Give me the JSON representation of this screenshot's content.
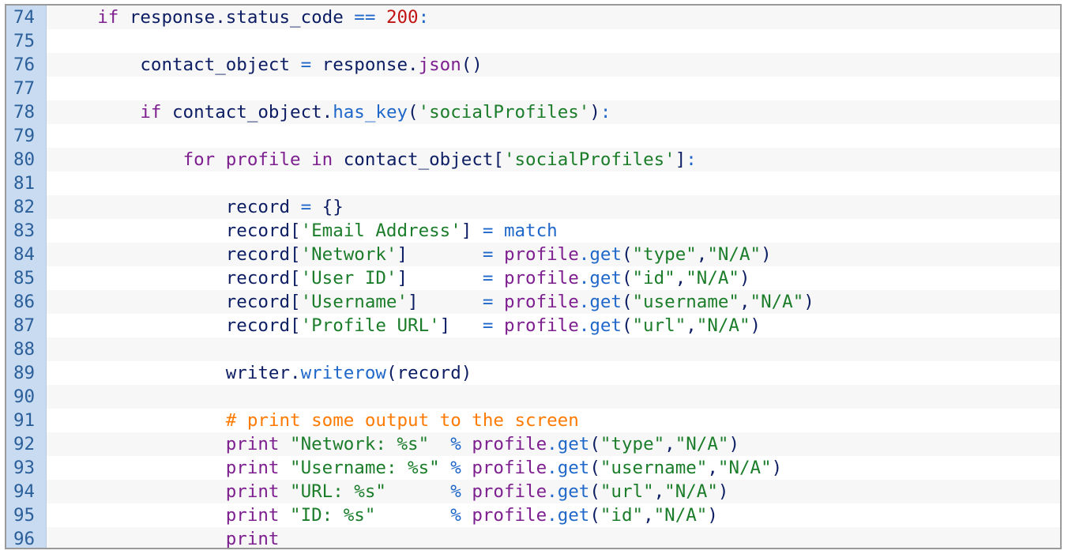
{
  "editor": {
    "lines": [
      {
        "number": "74",
        "tokens": [
          {
            "text": "    ",
            "type": "plain"
          },
          {
            "text": "if",
            "type": "kw"
          },
          {
            "text": " response.status_code ",
            "type": "name"
          },
          {
            "text": "==",
            "type": "op"
          },
          {
            "text": " ",
            "type": "plain"
          },
          {
            "text": "200",
            "type": "num"
          },
          {
            "text": ":",
            "type": "op"
          }
        ]
      },
      {
        "number": "75",
        "tokens": []
      },
      {
        "number": "76",
        "tokens": [
          {
            "text": "        contact_object ",
            "type": "name"
          },
          {
            "text": "=",
            "type": "op"
          },
          {
            "text": " response.",
            "type": "name"
          },
          {
            "text": "json",
            "type": "kw"
          },
          {
            "text": "()",
            "type": "plain"
          }
        ]
      },
      {
        "number": "77",
        "tokens": []
      },
      {
        "number": "78",
        "tokens": [
          {
            "text": "        ",
            "type": "plain"
          },
          {
            "text": "if",
            "type": "kw"
          },
          {
            "text": " contact_object.",
            "type": "name"
          },
          {
            "text": "has_key",
            "type": "fn"
          },
          {
            "text": "(",
            "type": "plain"
          },
          {
            "text": "'socialProfiles'",
            "type": "str"
          },
          {
            "text": ")",
            "type": "plain"
          },
          {
            "text": ":",
            "type": "op"
          }
        ]
      },
      {
        "number": "79",
        "tokens": []
      },
      {
        "number": "80",
        "tokens": [
          {
            "text": "            ",
            "type": "plain"
          },
          {
            "text": "for",
            "type": "kw"
          },
          {
            "text": " ",
            "type": "plain"
          },
          {
            "text": "profile",
            "type": "kw"
          },
          {
            "text": " ",
            "type": "plain"
          },
          {
            "text": "in",
            "type": "kw"
          },
          {
            "text": " contact_object[",
            "type": "name"
          },
          {
            "text": "'socialProfiles'",
            "type": "str"
          },
          {
            "text": "]",
            "type": "plain"
          },
          {
            "text": ":",
            "type": "op"
          }
        ]
      },
      {
        "number": "81",
        "tokens": []
      },
      {
        "number": "82",
        "tokens": [
          {
            "text": "                record ",
            "type": "name"
          },
          {
            "text": "=",
            "type": "op"
          },
          {
            "text": " {}",
            "type": "plain"
          }
        ]
      },
      {
        "number": "83",
        "tokens": [
          {
            "text": "                record[",
            "type": "name"
          },
          {
            "text": "'Email Address'",
            "type": "str"
          },
          {
            "text": "] ",
            "type": "plain"
          },
          {
            "text": "=",
            "type": "op"
          },
          {
            "text": " ",
            "type": "plain"
          },
          {
            "text": "match",
            "type": "fn"
          }
        ]
      },
      {
        "number": "84",
        "tokens": [
          {
            "text": "                record[",
            "type": "name"
          },
          {
            "text": "'Network'",
            "type": "str"
          },
          {
            "text": "]       ",
            "type": "plain"
          },
          {
            "text": "=",
            "type": "op"
          },
          {
            "text": " ",
            "type": "plain"
          },
          {
            "text": "profile",
            "type": "kw"
          },
          {
            "text": ".",
            "type": "op"
          },
          {
            "text": "get",
            "type": "fn"
          },
          {
            "text": "(",
            "type": "plain"
          },
          {
            "text": "\"type\"",
            "type": "str"
          },
          {
            "text": ",",
            "type": "plain"
          },
          {
            "text": "\"N/A\"",
            "type": "str"
          },
          {
            "text": ")",
            "type": "plain"
          }
        ]
      },
      {
        "number": "85",
        "tokens": [
          {
            "text": "                record[",
            "type": "name"
          },
          {
            "text": "'User ID'",
            "type": "str"
          },
          {
            "text": "]       ",
            "type": "plain"
          },
          {
            "text": "=",
            "type": "op"
          },
          {
            "text": " ",
            "type": "plain"
          },
          {
            "text": "profile",
            "type": "kw"
          },
          {
            "text": ".",
            "type": "op"
          },
          {
            "text": "get",
            "type": "fn"
          },
          {
            "text": "(",
            "type": "plain"
          },
          {
            "text": "\"id\"",
            "type": "str"
          },
          {
            "text": ",",
            "type": "plain"
          },
          {
            "text": "\"N/A\"",
            "type": "str"
          },
          {
            "text": ")",
            "type": "plain"
          }
        ]
      },
      {
        "number": "86",
        "tokens": [
          {
            "text": "                record[",
            "type": "name"
          },
          {
            "text": "'Username'",
            "type": "str"
          },
          {
            "text": "]      ",
            "type": "plain"
          },
          {
            "text": "=",
            "type": "op"
          },
          {
            "text": " ",
            "type": "plain"
          },
          {
            "text": "profile",
            "type": "kw"
          },
          {
            "text": ".",
            "type": "op"
          },
          {
            "text": "get",
            "type": "fn"
          },
          {
            "text": "(",
            "type": "plain"
          },
          {
            "text": "\"username\"",
            "type": "str"
          },
          {
            "text": ",",
            "type": "plain"
          },
          {
            "text": "\"N/A\"",
            "type": "str"
          },
          {
            "text": ")",
            "type": "plain"
          }
        ]
      },
      {
        "number": "87",
        "tokens": [
          {
            "text": "                record[",
            "type": "name"
          },
          {
            "text": "'Profile URL'",
            "type": "str"
          },
          {
            "text": "]   ",
            "type": "plain"
          },
          {
            "text": "=",
            "type": "op"
          },
          {
            "text": " ",
            "type": "plain"
          },
          {
            "text": "profile",
            "type": "kw"
          },
          {
            "text": ".",
            "type": "op"
          },
          {
            "text": "get",
            "type": "fn"
          },
          {
            "text": "(",
            "type": "plain"
          },
          {
            "text": "\"url\"",
            "type": "str"
          },
          {
            "text": ",",
            "type": "plain"
          },
          {
            "text": "\"N/A\"",
            "type": "str"
          },
          {
            "text": ")",
            "type": "plain"
          }
        ]
      },
      {
        "number": "88",
        "tokens": []
      },
      {
        "number": "89",
        "tokens": [
          {
            "text": "                writer.",
            "type": "name"
          },
          {
            "text": "writerow",
            "type": "fn"
          },
          {
            "text": "(record)",
            "type": "plain"
          }
        ]
      },
      {
        "number": "90",
        "tokens": []
      },
      {
        "number": "91",
        "tokens": [
          {
            "text": "                ",
            "type": "plain"
          },
          {
            "text": "# print some output to the screen",
            "type": "comment"
          }
        ]
      },
      {
        "number": "92",
        "tokens": [
          {
            "text": "                ",
            "type": "plain"
          },
          {
            "text": "print",
            "type": "kw"
          },
          {
            "text": " ",
            "type": "plain"
          },
          {
            "text": "\"Network: %s\"",
            "type": "str"
          },
          {
            "text": "  ",
            "type": "plain"
          },
          {
            "text": "%",
            "type": "op"
          },
          {
            "text": " ",
            "type": "plain"
          },
          {
            "text": "profile",
            "type": "kw"
          },
          {
            "text": ".",
            "type": "op"
          },
          {
            "text": "get",
            "type": "fn"
          },
          {
            "text": "(",
            "type": "plain"
          },
          {
            "text": "\"type\"",
            "type": "str"
          },
          {
            "text": ",",
            "type": "plain"
          },
          {
            "text": "\"N/A\"",
            "type": "str"
          },
          {
            "text": ")",
            "type": "plain"
          }
        ]
      },
      {
        "number": "93",
        "tokens": [
          {
            "text": "                ",
            "type": "plain"
          },
          {
            "text": "print",
            "type": "kw"
          },
          {
            "text": " ",
            "type": "plain"
          },
          {
            "text": "\"Username: %s\"",
            "type": "str"
          },
          {
            "text": " ",
            "type": "plain"
          },
          {
            "text": "%",
            "type": "op"
          },
          {
            "text": " ",
            "type": "plain"
          },
          {
            "text": "profile",
            "type": "kw"
          },
          {
            "text": ".",
            "type": "op"
          },
          {
            "text": "get",
            "type": "fn"
          },
          {
            "text": "(",
            "type": "plain"
          },
          {
            "text": "\"username\"",
            "type": "str"
          },
          {
            "text": ",",
            "type": "plain"
          },
          {
            "text": "\"N/A\"",
            "type": "str"
          },
          {
            "text": ")",
            "type": "plain"
          }
        ]
      },
      {
        "number": "94",
        "tokens": [
          {
            "text": "                ",
            "type": "plain"
          },
          {
            "text": "print",
            "type": "kw"
          },
          {
            "text": " ",
            "type": "plain"
          },
          {
            "text": "\"URL: %s\"",
            "type": "str"
          },
          {
            "text": "      ",
            "type": "plain"
          },
          {
            "text": "%",
            "type": "op"
          },
          {
            "text": " ",
            "type": "plain"
          },
          {
            "text": "profile",
            "type": "kw"
          },
          {
            "text": ".",
            "type": "op"
          },
          {
            "text": "get",
            "type": "fn"
          },
          {
            "text": "(",
            "type": "plain"
          },
          {
            "text": "\"url\"",
            "type": "str"
          },
          {
            "text": ",",
            "type": "plain"
          },
          {
            "text": "\"N/A\"",
            "type": "str"
          },
          {
            "text": ")",
            "type": "plain"
          }
        ]
      },
      {
        "number": "95",
        "tokens": [
          {
            "text": "                ",
            "type": "plain"
          },
          {
            "text": "print",
            "type": "kw"
          },
          {
            "text": " ",
            "type": "plain"
          },
          {
            "text": "\"ID: %s\"",
            "type": "str"
          },
          {
            "text": "       ",
            "type": "plain"
          },
          {
            "text": "%",
            "type": "op"
          },
          {
            "text": " ",
            "type": "plain"
          },
          {
            "text": "profile",
            "type": "kw"
          },
          {
            "text": ".",
            "type": "op"
          },
          {
            "text": "get",
            "type": "fn"
          },
          {
            "text": "(",
            "type": "plain"
          },
          {
            "text": "\"id\"",
            "type": "str"
          },
          {
            "text": ",",
            "type": "plain"
          },
          {
            "text": "\"N/A\"",
            "type": "str"
          },
          {
            "text": ")",
            "type": "plain"
          }
        ]
      },
      {
        "number": "96",
        "tokens": [
          {
            "text": "                ",
            "type": "plain"
          },
          {
            "text": "print",
            "type": "kw"
          }
        ]
      }
    ]
  },
  "colors": {
    "gutter_background": "#c8dbf1",
    "gutter_text": "#2b5f9a",
    "frame_border": "#9a9a9a",
    "keyword": "#7d1f8f",
    "identifier": "#0c1d63",
    "operator": "#1f67c9",
    "number": "#c21313",
    "string": "#1b7d2a",
    "comment": "#ff7a00"
  }
}
